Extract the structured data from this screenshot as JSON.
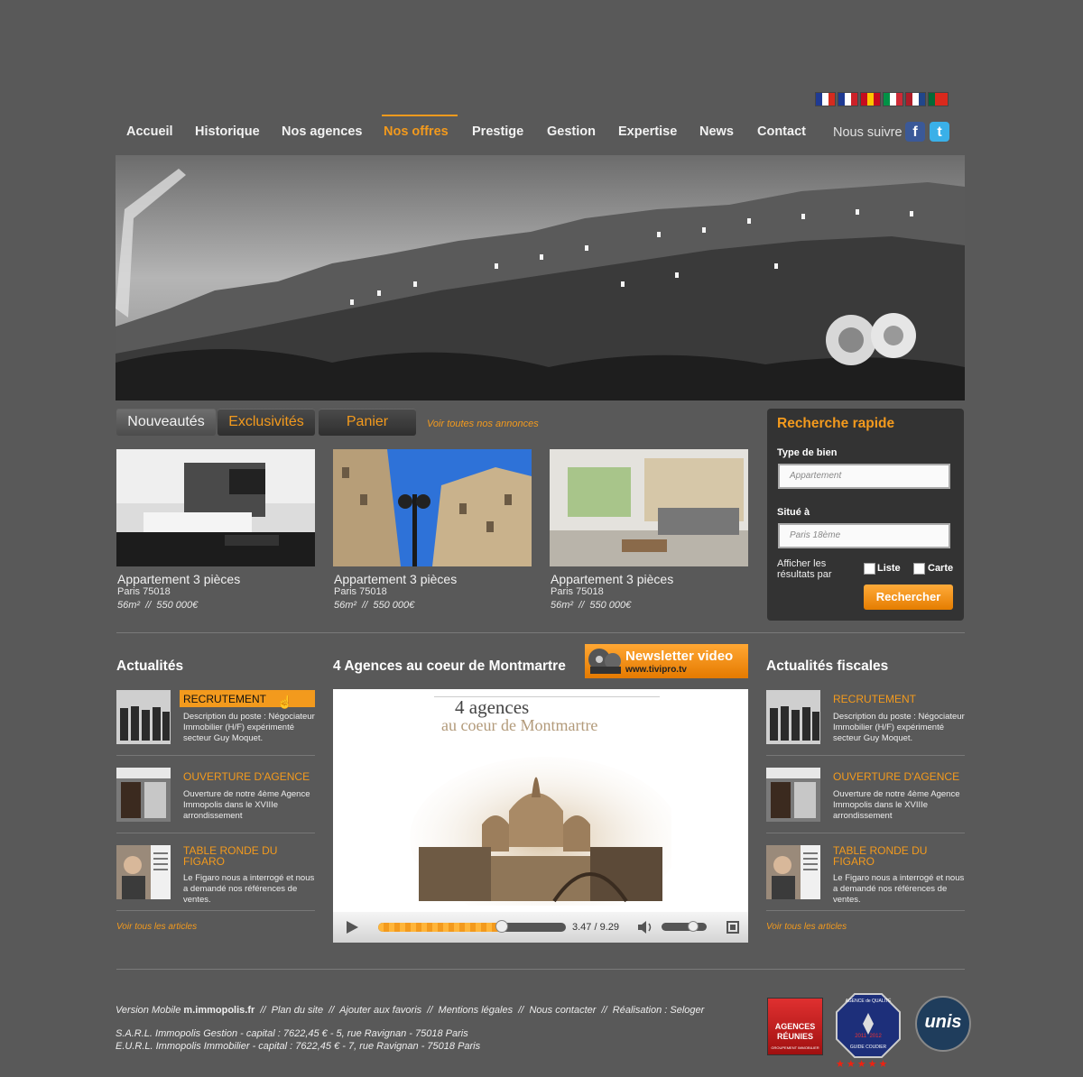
{
  "flags": [
    {
      "name": "fr",
      "colors": [
        "#1f3a93",
        "#ffffff",
        "#d52b1e"
      ]
    },
    {
      "name": "uk",
      "colors": [
        "#1f3a93",
        "#ffffff",
        "#cc2229"
      ]
    },
    {
      "name": "es",
      "colors": [
        "#c60b1e",
        "#ffc400",
        "#c60b1e"
      ]
    },
    {
      "name": "it",
      "colors": [
        "#009246",
        "#ffffff",
        "#ce2b37"
      ]
    },
    {
      "name": "nl",
      "colors": [
        "#ae1c28",
        "#ffffff",
        "#21468b"
      ]
    },
    {
      "name": "pt",
      "colors": [
        "#046a38",
        "#da291c",
        "#da291c"
      ]
    }
  ],
  "nav": {
    "items": [
      "Accueil",
      "Historique",
      "Nos agences",
      "Nos offres",
      "Prestige",
      "Gestion",
      "Expertise",
      "News",
      "Contact"
    ],
    "active": "Nos offres",
    "follow_label": "Nous suivre",
    "facebook_icon": "facebook-icon",
    "twitter_icon": "twitter-icon"
  },
  "tabs": {
    "items": [
      "Nouveautés",
      "Exclusivités",
      "Panier"
    ],
    "selected": "Nouveautés",
    "all_link": "Voir toutes nos annonces"
  },
  "listings": [
    {
      "title": "Appartement 3 pièces",
      "location": "Paris 75018",
      "details": "56m²  //  550 000€"
    },
    {
      "title": "Appartement 3 pièces",
      "location": "Paris 75018",
      "details": "56m²  //  550 000€"
    },
    {
      "title": "Appartement 3 pièces",
      "location": "Paris 75018",
      "details": "56m²  //  550 000€"
    }
  ],
  "search": {
    "title": "Recherche rapide",
    "type_label": "Type de bien",
    "type_placeholder": "Appartement",
    "location_label": "Situé à",
    "location_placeholder": "Paris 18ème",
    "display_label": "Afficher les résultats par",
    "opt_list": "Liste",
    "opt_map": "Carte",
    "submit": "Rechercher"
  },
  "news": {
    "title": "Actualités",
    "items": [
      {
        "title": "RECRUTEMENT",
        "desc": "Description du poste : Négociateur Immobilier (H/F) expérimenté secteur Guy Moquet."
      },
      {
        "title": "OUVERTURE D'AGENCE",
        "desc": "Ouverture de notre 4ème Agence Immopolis dans le XVIIIe arrondissement"
      },
      {
        "title": "TABLE RONDE DU FIGARO",
        "desc": "Le Figaro nous a interrogé et nous a demandé nos références de ventes."
      }
    ],
    "all_link": "Voir tous les articles"
  },
  "video": {
    "title": "4 Agences au coeur de Montmartre",
    "newsletter_title": "Newsletter video",
    "newsletter_url": "www.tivipro.tv",
    "heading_line1": "4 agences",
    "heading_line2": "au coeur de Montmartre",
    "time": "3.47 / 9.29",
    "progress": 0.66,
    "volume": 0.7
  },
  "fiscal": {
    "title": "Actualités fiscales",
    "items": [
      {
        "title": "RECRUTEMENT",
        "desc": "Description du poste : Négociateur Immobilier (H/F) expérimenté secteur Guy Moquet."
      },
      {
        "title": "OUVERTURE D'AGENCE",
        "desc": "Ouverture de notre 4ème Agence Immopolis dans le XVIIIe arrondissement"
      },
      {
        "title": "TABLE RONDE DU FIGARO",
        "desc": "Le Figaro nous a interrogé et nous a demandé nos références de ventes."
      }
    ],
    "all_link": "Voir tous les articles"
  },
  "footer": {
    "mobile_prefix": "Version Mobile",
    "mobile_site": "m.immopolis.fr",
    "links": [
      "Plan du site",
      "Ajouter aux favoris",
      "Mentions légales",
      "Nous contacter",
      "Réalisation : Seloger"
    ],
    "legal1": "S.A.R.L. Immopolis Gestion - capital : 7622,45 € - 5, rue Ravignan - 75018 Paris",
    "legal2": "E.U.R.L. Immopolis Immobilier - capital : 7622,45 € - 7, rue Ravignan - 75018 Paris",
    "badge1_line1": "AGENCES",
    "badge1_line2": "RÉUNIES",
    "badge1_line3": "GROUPEMENT IMMOBILIER",
    "badge2_line1": "AGENCE de QUALITÉ",
    "badge2_years": "2011  2012",
    "badge2_line3": "GUIDE COUDIER",
    "badge3": "unis"
  },
  "colors": {
    "accent": "#f39a1d",
    "bg": "#595959"
  }
}
